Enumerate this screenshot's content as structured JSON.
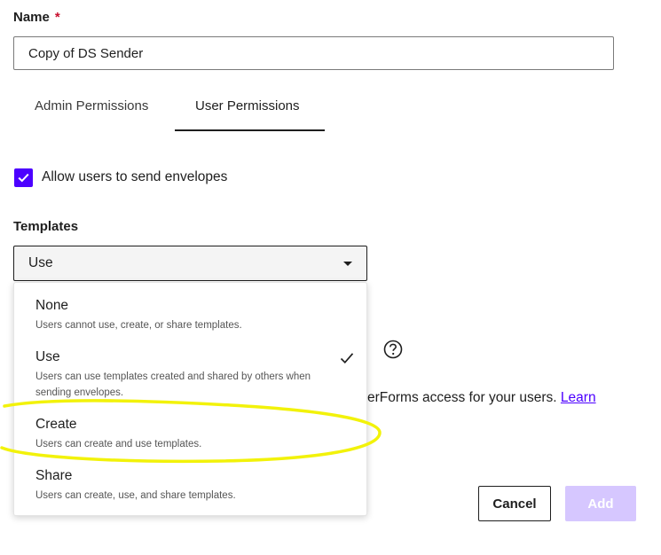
{
  "form": {
    "name_label": "Name",
    "required_mark": "*",
    "name_value": "Copy of DS Sender"
  },
  "tabs": [
    {
      "label": "Admin Permissions",
      "active": false
    },
    {
      "label": "User Permissions",
      "active": true
    }
  ],
  "send_envelopes": {
    "label": "Allow users to send envelopes",
    "checked": true
  },
  "templates": {
    "label": "Templates",
    "selected": "Use",
    "options": [
      {
        "title": "None",
        "desc": "Users cannot use, create, or share templates."
      },
      {
        "title": "Use",
        "desc": "Users can use templates created and shared by others when sending envelopes.",
        "selected": true
      },
      {
        "title": "Create",
        "desc": "Users can create and use templates."
      },
      {
        "title": "Share",
        "desc": "Users can create, use, and share templates."
      }
    ]
  },
  "forms_access": {
    "text": "erForms access for your users.",
    "link": "Learn"
  },
  "buttons": {
    "cancel": "Cancel",
    "add": "Add"
  },
  "colors": {
    "accent": "#4c00ff",
    "add_disabled": "#d6c7ff",
    "highlight": "#f2f20a"
  }
}
